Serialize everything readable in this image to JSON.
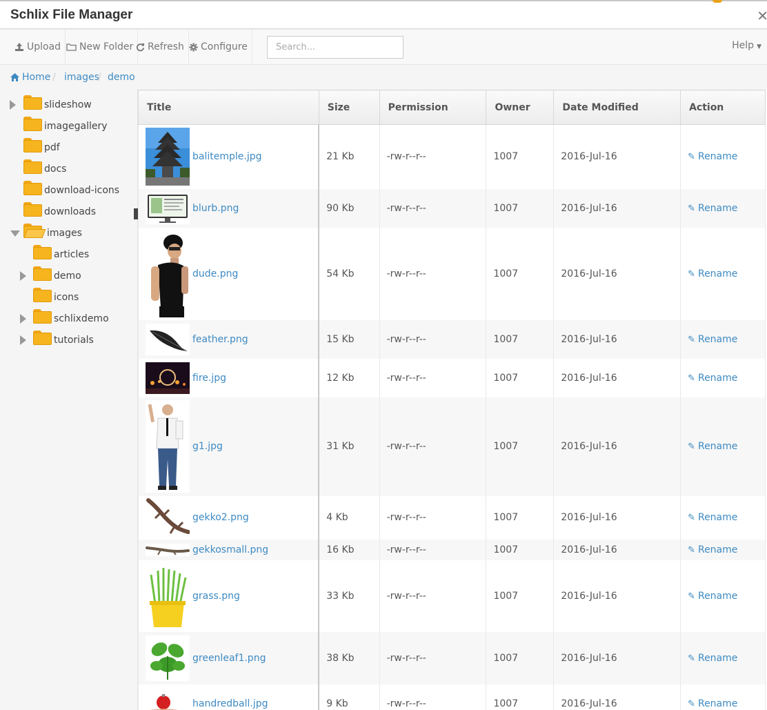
{
  "window": {
    "title": "Schlix File Manager",
    "close_glyph": "✕"
  },
  "toolbar": {
    "buttons": [
      {
        "icon": "upload-icon",
        "label": "Upload"
      },
      {
        "icon": "folder-outline-icon",
        "label": "New Folder"
      },
      {
        "icon": "refresh-icon",
        "label": "Refresh"
      },
      {
        "icon": "gear-icon",
        "label": "Configure"
      }
    ],
    "search_placeholder": "Search...",
    "help_label": "Help"
  },
  "breadcrumb": {
    "items": [
      "Home",
      "images",
      "demo"
    ],
    "separator": "/"
  },
  "tree": [
    {
      "label": "slideshow",
      "expander": "collapsed"
    },
    {
      "label": "imagegallery",
      "expander": "none"
    },
    {
      "label": "pdf",
      "expander": "none"
    },
    {
      "label": "docs",
      "expander": "none"
    },
    {
      "label": "download-icons",
      "expander": "none"
    },
    {
      "label": "downloads",
      "expander": "none"
    },
    {
      "label": "images",
      "expander": "expanded"
    },
    {
      "label": "articles",
      "expander": "none"
    },
    {
      "label": "demo",
      "expander": "collapsed"
    },
    {
      "label": "icons",
      "expander": "none"
    },
    {
      "label": "schlixdemo",
      "expander": "collapsed"
    },
    {
      "label": "tutorials",
      "expander": "collapsed"
    }
  ],
  "table": {
    "headers": [
      "Title",
      "Size",
      "Permission",
      "Owner",
      "Date Modified",
      "Action"
    ],
    "rows": [
      {
        "name": "balitemple.jpg",
        "size": "21 Kb",
        "perm": "-rw-r--r--",
        "owner": "1007",
        "date": "2016-Jul-16",
        "action": "Rename"
      },
      {
        "name": "blurb.png",
        "size": "90 Kb",
        "perm": "-rw-r--r--",
        "owner": "1007",
        "date": "2016-Jul-16",
        "action": "Rename"
      },
      {
        "name": "dude.png",
        "size": "54 Kb",
        "perm": "-rw-r--r--",
        "owner": "1007",
        "date": "2016-Jul-16",
        "action": "Rename"
      },
      {
        "name": "feather.png",
        "size": "15 Kb",
        "perm": "-rw-r--r--",
        "owner": "1007",
        "date": "2016-Jul-16",
        "action": "Rename"
      },
      {
        "name": "fire.jpg",
        "size": "12 Kb",
        "perm": "-rw-r--r--",
        "owner": "1007",
        "date": "2016-Jul-16",
        "action": "Rename"
      },
      {
        "name": "g1.jpg",
        "size": "31 Kb",
        "perm": "-rw-r--r--",
        "owner": "1007",
        "date": "2016-Jul-16",
        "action": "Rename"
      },
      {
        "name": "gekko2.png",
        "size": "4 Kb",
        "perm": "-rw-r--r--",
        "owner": "1007",
        "date": "2016-Jul-16",
        "action": "Rename"
      },
      {
        "name": "gekkosmall.png",
        "size": "16 Kb",
        "perm": "-rw-r--r--",
        "owner": "1007",
        "date": "2016-Jul-16",
        "action": "Rename"
      },
      {
        "name": "grass.png",
        "size": "33 Kb",
        "perm": "-rw-r--r--",
        "owner": "1007",
        "date": "2016-Jul-16",
        "action": "Rename"
      },
      {
        "name": "greenleaf1.png",
        "size": "38 Kb",
        "perm": "-rw-r--r--",
        "owner": "1007",
        "date": "2016-Jul-16",
        "action": "Rename"
      },
      {
        "name": "handredball.jpg",
        "size": "9 Kb",
        "perm": "-rw-r--r--",
        "owner": "1007",
        "date": "2016-Jul-16",
        "action": "Rename"
      }
    ]
  },
  "colors": {
    "link": "#3e8ac2",
    "folder": "#f6b41e",
    "toolbar_bg": "#f8f8f8"
  }
}
